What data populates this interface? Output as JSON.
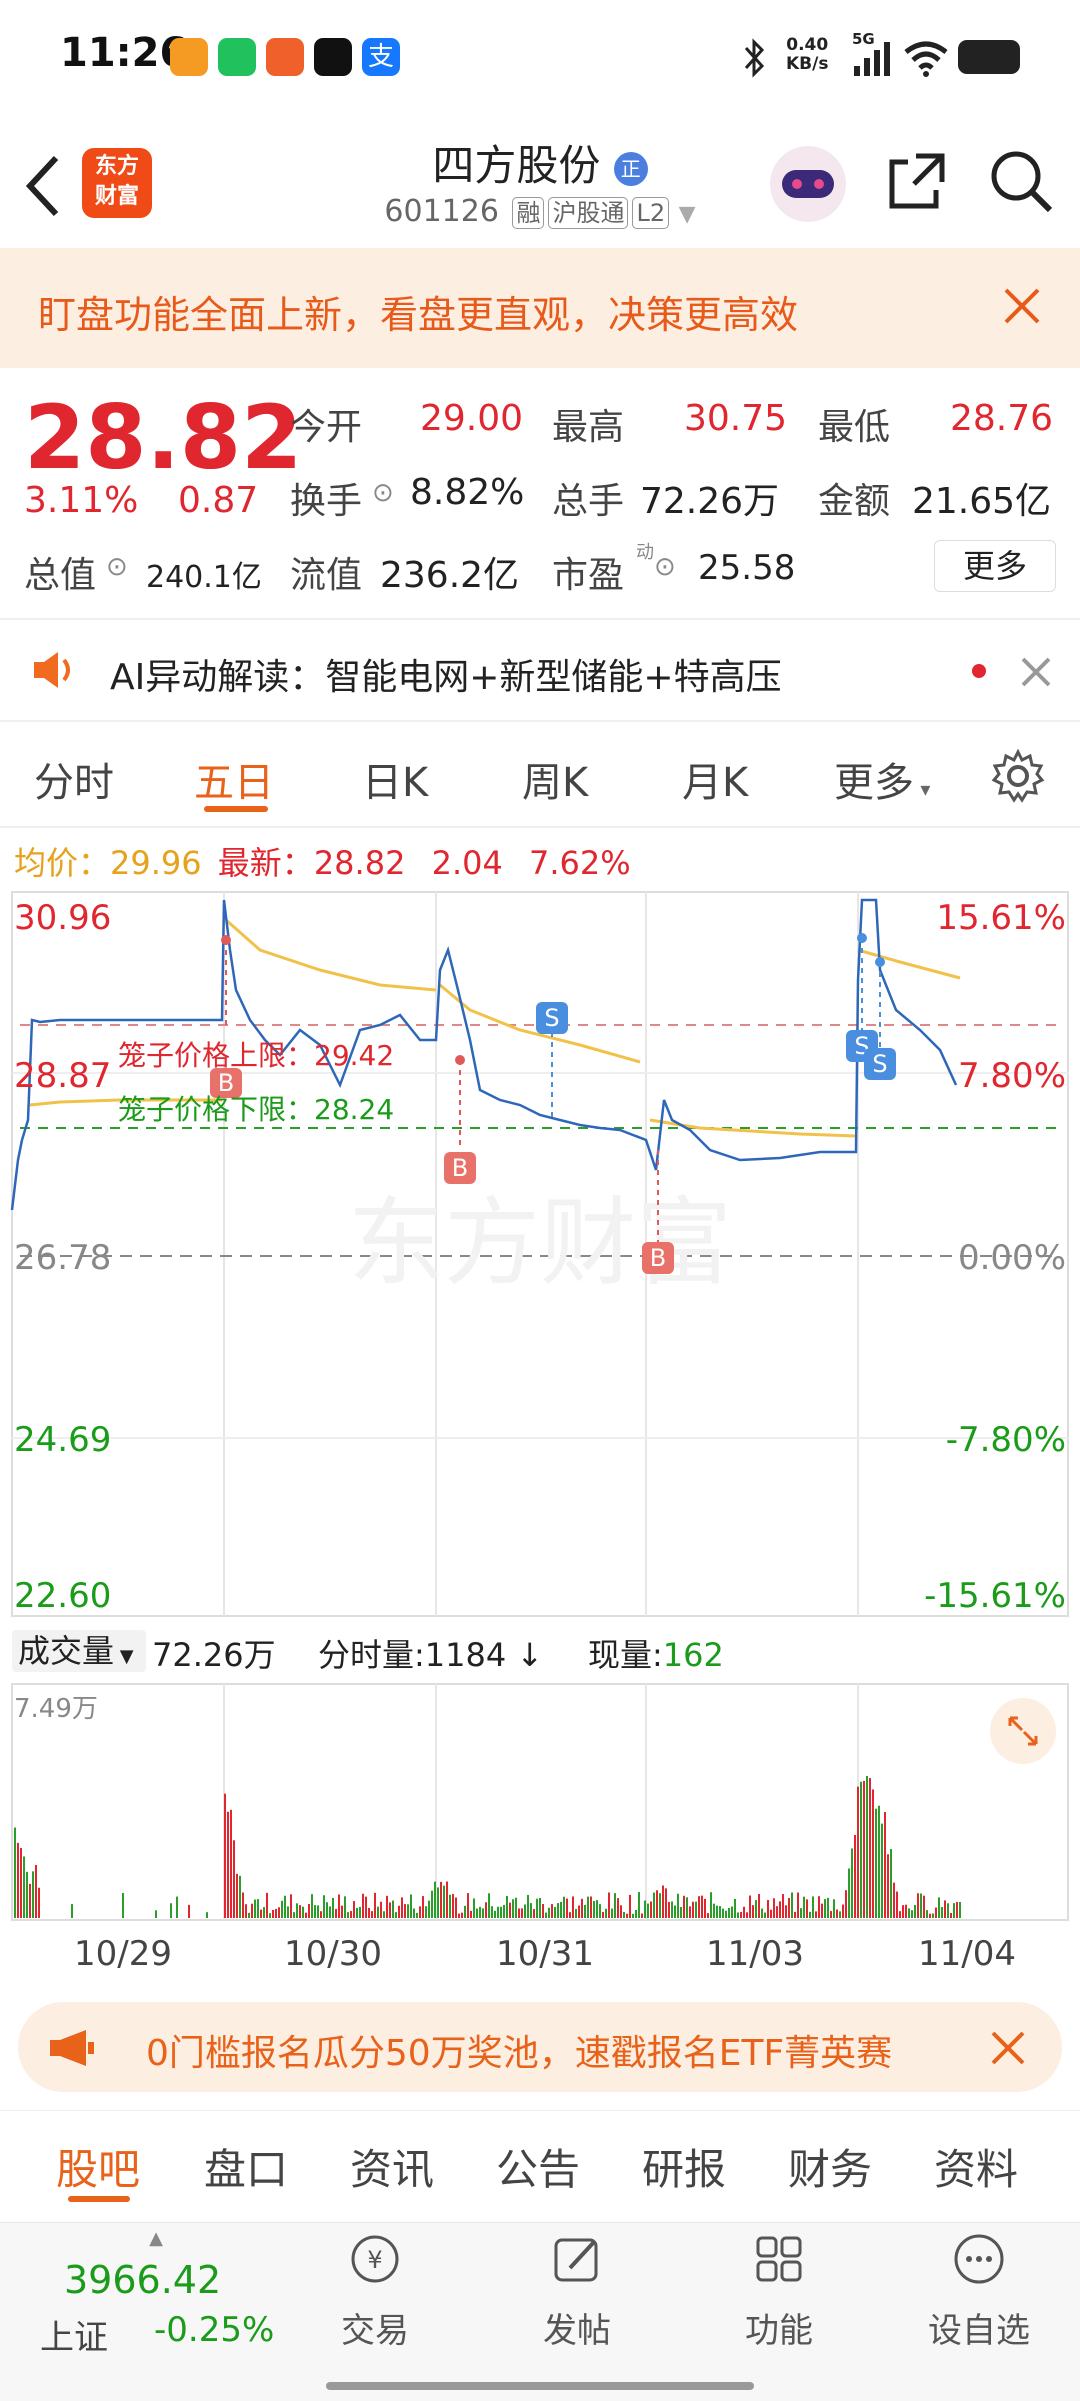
{
  "status_bar": {
    "time": "11:26",
    "net_speed_value": "0.40",
    "net_speed_unit": "KB/s",
    "signal": "5G"
  },
  "header": {
    "back_icon": "chevron-left-icon",
    "logo_text_1": "东方",
    "logo_text_2": "财富",
    "stock_name": "四方股份",
    "name_badge": "正",
    "stock_code": "601126",
    "tags": [
      "融",
      "沪股通",
      "L2"
    ],
    "share_icon": "share-icon",
    "search_icon": "search-icon"
  },
  "banner": {
    "text": "盯盘功能全面上新，看盘更直观，决策更高效"
  },
  "quote": {
    "price": "28.82",
    "change_pct": "3.11%",
    "change_amt": "0.87",
    "open_label": "今开",
    "open": "29.00",
    "high_label": "最高",
    "high": "30.75",
    "low_label": "最低",
    "low": "28.76",
    "turnover_label": "换手",
    "turnover": "8.82%",
    "volume_label": "总手",
    "volume": "72.26万",
    "amount_label": "金额",
    "amount": "21.65亿",
    "mktcap_label": "总值",
    "mktcap": "240.1亿",
    "float_label": "流值",
    "float_cap": "236.2亿",
    "pe_label": "市盈",
    "pe_sup": "动",
    "pe": "25.58",
    "more_button": "更多"
  },
  "ai_bar": {
    "text": "AI异动解读：智能电网+新型储能+特高压"
  },
  "tabs": [
    "分时",
    "五日",
    "日K",
    "周K",
    "月K",
    "更多"
  ],
  "active_tab": 1,
  "chart_header": {
    "avg_label": "均价：",
    "avg": "29.96",
    "latest_label": "最新：",
    "latest": "28.82",
    "chg": "2.04",
    "chg_pct": "7.62%"
  },
  "chart": {
    "left_axis": [
      "30.96",
      "28.87",
      "26.78",
      "24.69",
      "22.60"
    ],
    "right_axis": [
      "15.61%",
      "7.80%",
      "0.00%",
      "-7.80%",
      "-15.61%"
    ],
    "cage_upper_label": "笼子价格上限：29.42",
    "cage_lower_label": "笼子价格下限：28.24",
    "watermark": "东方财富",
    "markers": [
      "B",
      "B",
      "S",
      "B",
      "S",
      "S"
    ]
  },
  "volume_bar": {
    "label": "成交量",
    "total": "72.26万",
    "minute_label": "分时量:",
    "minute_val": "1184",
    "now_label": "现量:",
    "now_val": "162",
    "max_label": "7.49万"
  },
  "dates": [
    "10/29",
    "10/30",
    "10/31",
    "11/03",
    "11/04"
  ],
  "promo": {
    "text": "0门槛报名瓜分50万奖池，速戳报名ETF菁英赛"
  },
  "bottom_tabs": [
    "股吧",
    "盘口",
    "资讯",
    "公告",
    "研报",
    "财务",
    "资料"
  ],
  "bottom_nav": {
    "index_value": "3966.42",
    "index_name": "上证",
    "index_chg": "-0.25%",
    "items": [
      "交易",
      "发帖",
      "功能",
      "设自选"
    ]
  },
  "chart_data": {
    "type": "line",
    "title": "",
    "x": [
      "10/29",
      "10/30",
      "10/31",
      "11/03",
      "11/04"
    ],
    "ylim": [
      22.6,
      30.96
    ],
    "series": [
      {
        "name": "",
        "values": [
          29.0,
          29.1,
          29.4,
          28.4,
          29.6
        ]
      }
    ],
    "reference_lines": {
      "prev_close": 26.78,
      "cage_upper": 29.42,
      "cage_lower": 28.24
    }
  }
}
